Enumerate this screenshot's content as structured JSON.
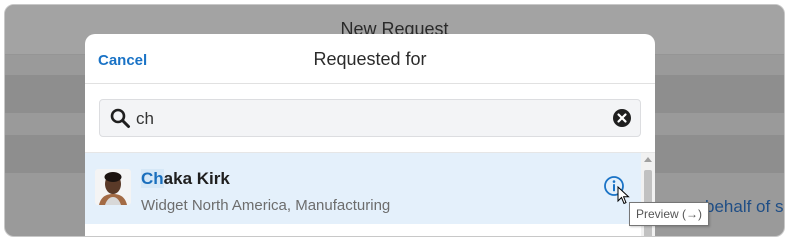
{
  "background": {
    "title": "New Request",
    "link_text": "behalf of so"
  },
  "modal": {
    "cancel_label": "Cancel",
    "title": "Requested for",
    "search": {
      "value": "ch",
      "icon": "search-icon",
      "clear_icon": "clear-icon"
    },
    "results": [
      {
        "name_highlight": "Ch",
        "name_rest": "aka Kirk",
        "subtitle": "Widget North America, Manufacturing",
        "info_icon": "info-icon"
      }
    ]
  },
  "tooltip": {
    "text": "Preview (→)"
  },
  "colors": {
    "accent": "#1a73c6",
    "row_highlight": "#e4f0fb",
    "overlay": "#9a9a9a"
  }
}
